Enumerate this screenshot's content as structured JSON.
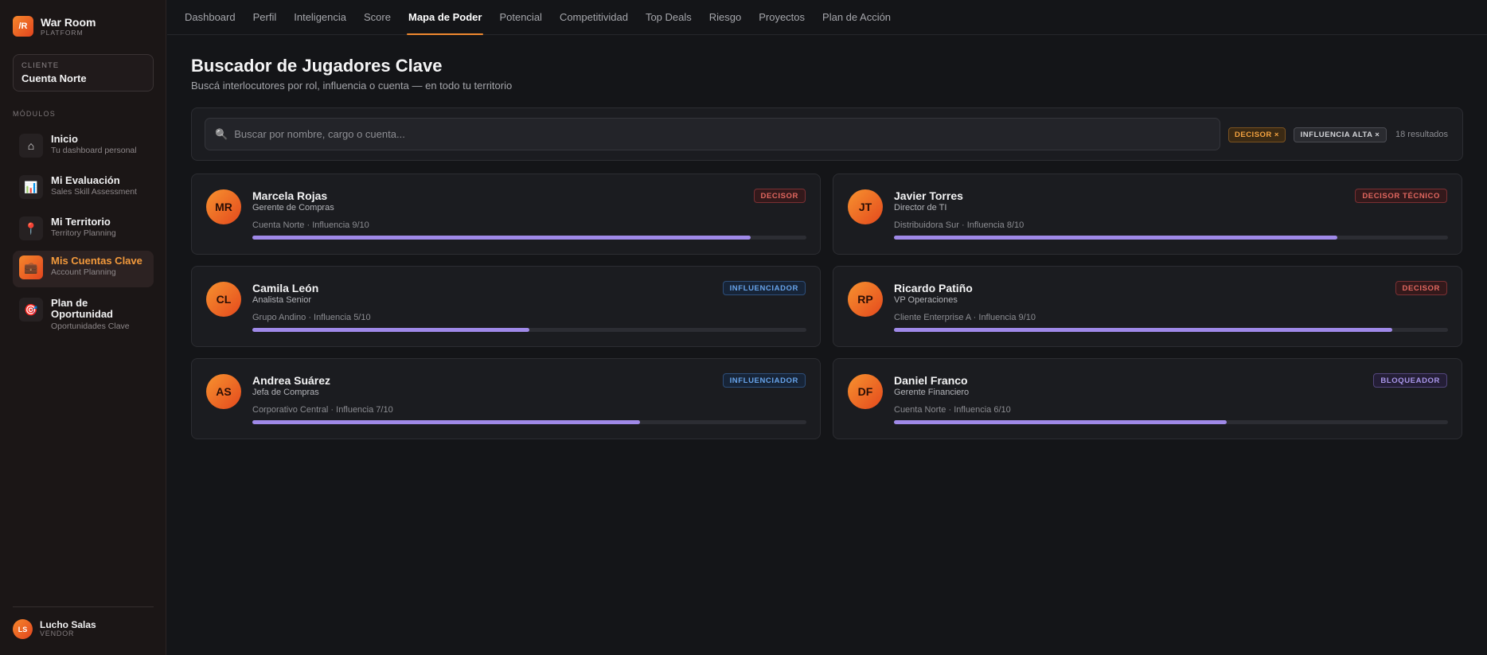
{
  "brand": {
    "logo_text": "/R",
    "name": "War Room",
    "sub": "PLATFORM"
  },
  "client": {
    "label": "CLIENTE",
    "name": "Cuenta Norte"
  },
  "sidebar": {
    "section_title": "MÓDULOS",
    "items": [
      {
        "label": "Inicio",
        "sub": "Tu dashboard personal",
        "icon": "home-icon",
        "glyph": "⌂"
      },
      {
        "label": "Mi Evaluación",
        "sub": "Sales Skill Assessment",
        "icon": "chart-icon",
        "glyph": "📊"
      },
      {
        "label": "Mi Territorio",
        "sub": "Territory Planning",
        "icon": "map-pin-icon",
        "glyph": "📍"
      },
      {
        "label": "Mis Cuentas Clave",
        "sub": "Account Planning",
        "icon": "briefcase-icon",
        "glyph": "💼"
      },
      {
        "label": "Plan de Oportunidad",
        "sub": "Oportunidades Clave",
        "icon": "target-icon",
        "glyph": "🎯"
      }
    ],
    "active_index": 3
  },
  "user": {
    "initials": "LS",
    "name": "Lucho Salas",
    "role": "VENDOR"
  },
  "topnav": {
    "tabs": [
      "Dashboard",
      "Perfil",
      "Inteligencia",
      "Score",
      "Mapa de Poder",
      "Potencial",
      "Competitividad",
      "Top Deals",
      "Riesgo",
      "Proyectos",
      "Plan de Acción"
    ],
    "active_index": 4
  },
  "page": {
    "title": "Buscador de Jugadores Clave",
    "subtitle": "Buscá interlocutores por rol, influencia o cuenta — en todo tu territorio"
  },
  "search": {
    "placeholder": "Buscar por nombre, cargo o cuenta...",
    "value": "",
    "filters": [
      "DECISOR ×",
      "INFLUENCIA ALTA ×"
    ],
    "results_count": "18 resultados"
  },
  "colors": {
    "accent": "#f0892f",
    "bar": "#9f89e8",
    "decisor": "#e2675f",
    "influenciador": "#67a3ea",
    "bloqueador": "#a996ea"
  },
  "players": [
    {
      "initials": "MR",
      "name": "Marcela Rojas",
      "role": "Gerente de Compras",
      "meta": "Cuenta Norte · Influencia 9/10",
      "influence": 9,
      "badge": "DECISOR",
      "badge_type": "decisor"
    },
    {
      "initials": "JT",
      "name": "Javier Torres",
      "role": "Director de TI",
      "meta": "Distribuidora Sur · Influencia 8/10",
      "influence": 8,
      "badge": "DECISOR TÉCNICO",
      "badge_type": "decisor"
    },
    {
      "initials": "CL",
      "name": "Camila León",
      "role": "Analista Senior",
      "meta": "Grupo Andino · Influencia 5/10",
      "influence": 5,
      "badge": "INFLUENCIADOR",
      "badge_type": "influenciador"
    },
    {
      "initials": "RP",
      "name": "Ricardo Patiño",
      "role": "VP Operaciones",
      "meta": "Cliente Enterprise A · Influencia 9/10",
      "influence": 9,
      "badge": "DECISOR",
      "badge_type": "decisor"
    },
    {
      "initials": "AS",
      "name": "Andrea Suárez",
      "role": "Jefa de Compras",
      "meta": "Corporativo Central · Influencia 7/10",
      "influence": 7,
      "badge": "INFLUENCIADOR",
      "badge_type": "influenciador"
    },
    {
      "initials": "DF",
      "name": "Daniel Franco",
      "role": "Gerente Financiero",
      "meta": "Cuenta Norte · Influencia 6/10",
      "influence": 6,
      "badge": "BLOQUEADOR",
      "badge_type": "bloqueador"
    }
  ]
}
